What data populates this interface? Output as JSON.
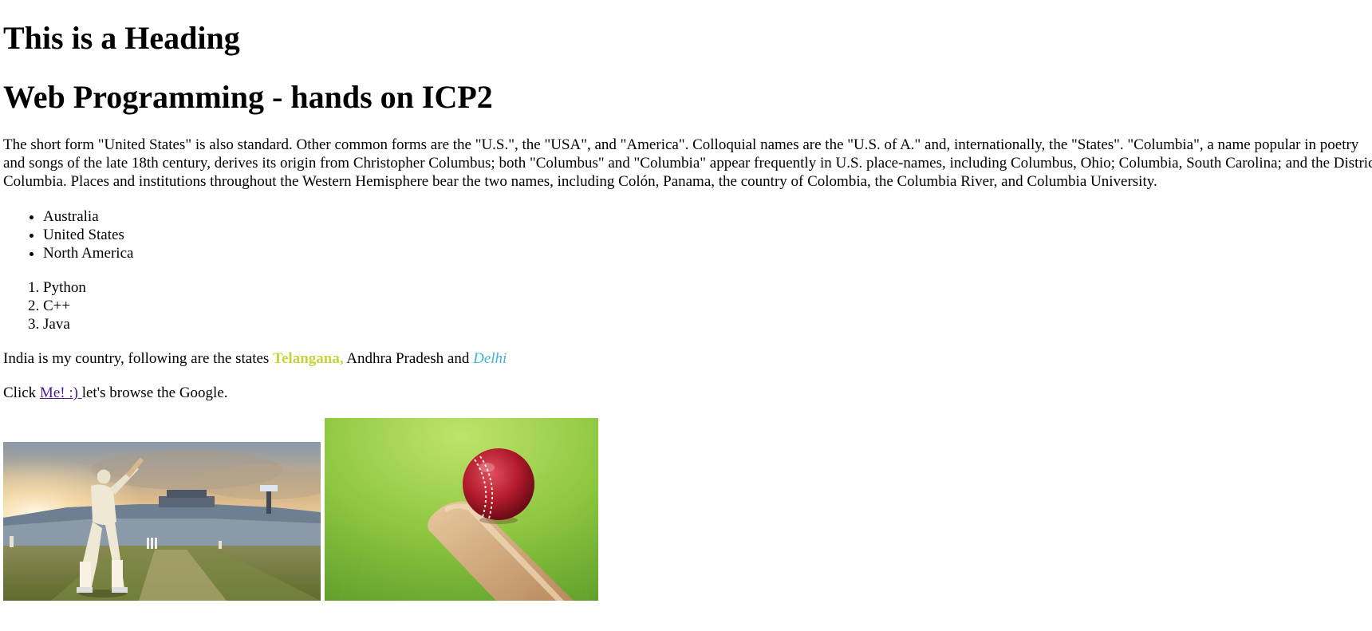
{
  "page": {
    "heading1": "This is a Heading",
    "heading2": "Web Programming - hands on ICP2"
  },
  "paragraph": {
    "line1": "The short form \"United States\" is also standard. Other common forms are the \"U.S.\", the \"USA\", and \"America\". Colloquial names are the \"U.S. of A.\" and, internationally, the \"States\". \"Columbia\", a name popular in poetry",
    "line2": "and songs of the late 18th century, derives its origin from Christopher Columbus; both \"Columbus\" and \"Columbia\" appear frequently in U.S. place-names, including Columbus, Ohio; Columbia, South Carolina; and the District of",
    "line3": "Columbia. Places and institutions throughout the Western Hemisphere bear the two names, including Colón, Panama, the country of Colombia, the Columbia River, and Columbia University."
  },
  "countries": [
    "Australia",
    "United States",
    "North America"
  ],
  "languages": [
    "Python",
    "C++",
    "Java"
  ],
  "states_line": {
    "prefix": "India is my country, following are the states ",
    "telangana": "Telangana,",
    "middle": " Andhra Pradesh and ",
    "delhi": "Delhi"
  },
  "click_line": {
    "prefix": "Click ",
    "link": "Me! :) ",
    "suffix": "let's browse the Google."
  },
  "colors": {
    "telangana": "#c6d43c",
    "delhi": "#3bb6d6",
    "link": "#4b1c8c"
  }
}
